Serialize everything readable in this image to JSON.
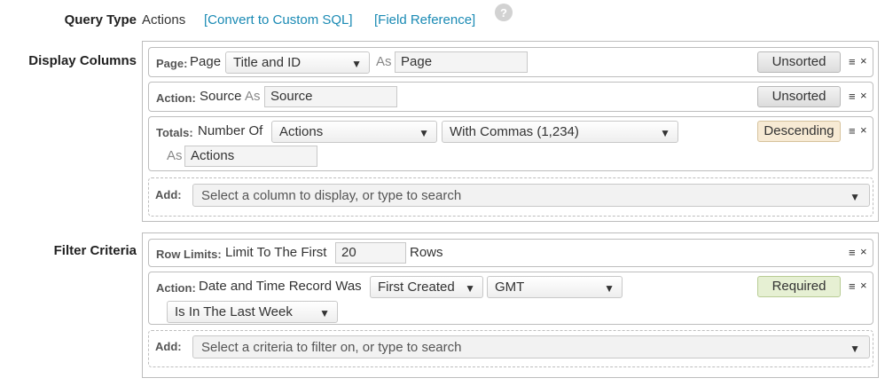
{
  "header": {
    "query_type_label": "Query Type",
    "query_type_value": "Actions",
    "convert_link": "[Convert to Custom SQL]",
    "field_reference_link": "[Field Reference]",
    "help_icon_glyph": "?"
  },
  "display_columns": {
    "label": "Display Columns",
    "rows": [
      {
        "tag": "Page:",
        "text": "Page",
        "select_value": "Title and ID",
        "as_label": "As",
        "alias": "Page",
        "sort": "Unsorted"
      },
      {
        "tag": "Action:",
        "text": "Source",
        "as_label": "As",
        "alias": "Source",
        "sort": "Unsorted"
      },
      {
        "tag": "Totals:",
        "text": "Number Of",
        "select_value": "Actions",
        "format_value": "With Commas (1,234)",
        "as_label": "As",
        "alias": "Actions",
        "sort": "Descending"
      }
    ],
    "add_label": "Add:",
    "add_placeholder": "Select a column to display, or type to search"
  },
  "filter_criteria": {
    "label": "Filter Criteria",
    "row_limits": {
      "tag": "Row Limits:",
      "text_before": "Limit To The First",
      "value": "20",
      "text_after": "Rows"
    },
    "action_filter": {
      "tag": "Action:",
      "text": "Date and Time Record Was",
      "select_value": "First Created",
      "timezone": "GMT",
      "range": "Is In The Last Week",
      "badge": "Required"
    },
    "add_label": "Add:",
    "add_placeholder": "Select a criteria to filter on, or type to search"
  },
  "controls": {
    "menu_glyph": "≡",
    "close_glyph": "×",
    "caret_glyph": "▼"
  }
}
